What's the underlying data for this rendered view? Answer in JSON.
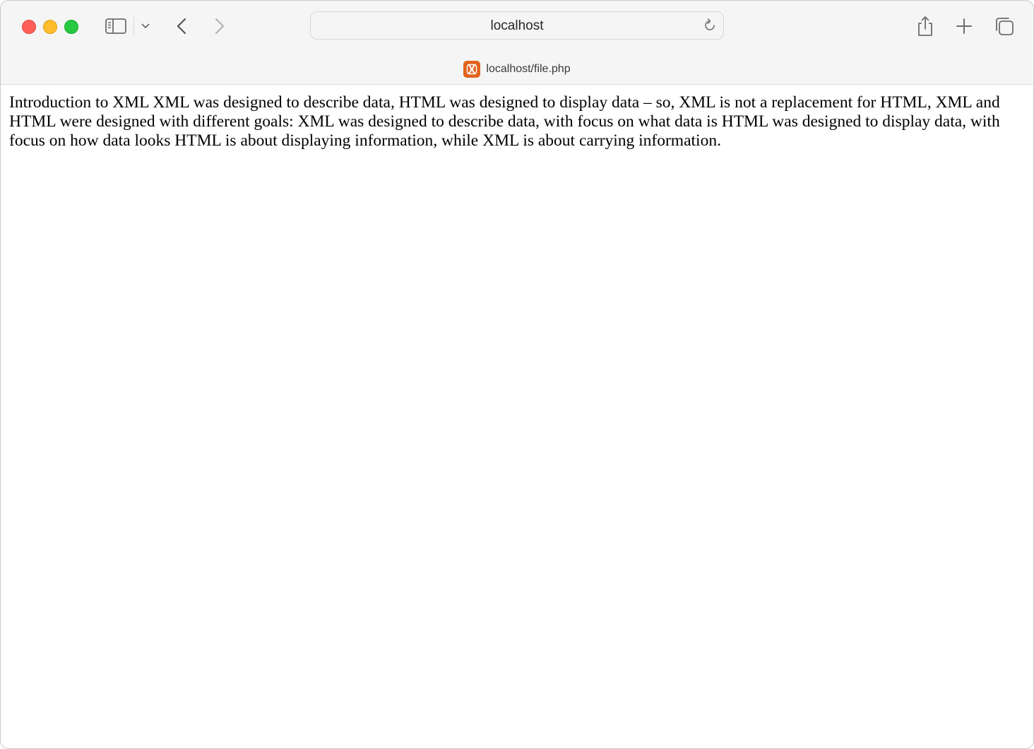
{
  "browser": {
    "address_bar": {
      "text": "localhost"
    },
    "tab": {
      "title": "localhost/file.php",
      "favicon": "xampp-logo-icon",
      "favicon_color": "#e2641d"
    },
    "icons": {
      "sidebar": "sidebar-icon",
      "tab_group": "chevron-down-icon",
      "back": "chevron-left-icon",
      "forward": "chevron-right-icon",
      "reload": "reload-icon",
      "share": "share-icon",
      "new_tab": "plus-icon",
      "tab_overview": "tab-overview-icon"
    },
    "traffic_lights": {
      "close": "#fe5f57",
      "minimize": "#febc2e",
      "maximize": "#28c840"
    }
  },
  "page": {
    "body_text": "Introduction to XML XML was designed to describe data, HTML was designed to display data – so, XML is not a replacement for HTML, XML and HTML were designed with different goals: XML was designed to describe data, with focus on what data is HTML was designed to display data, with focus on how data looks HTML is about displaying information, while XML is about carrying information."
  }
}
